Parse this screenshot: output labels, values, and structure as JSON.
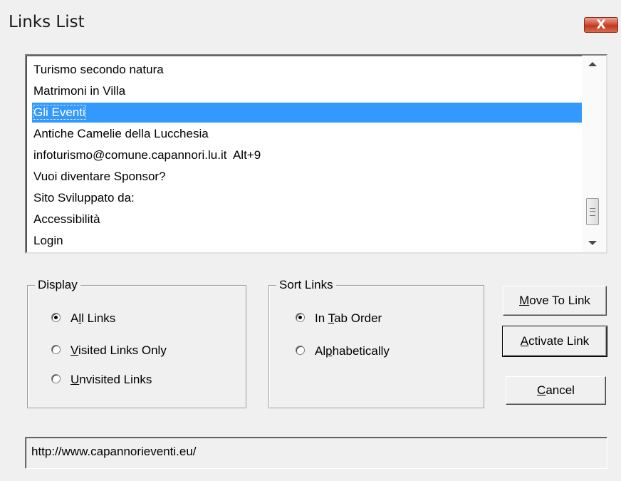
{
  "window": {
    "title": "Links List",
    "close_label": "X"
  },
  "links": [
    {
      "label": "Turismo secondo natura",
      "selected": false
    },
    {
      "label": "Matrimoni in Villa",
      "selected": false
    },
    {
      "label": "Gli Eventi",
      "selected": true
    },
    {
      "label": "Antiche Camelie della Lucchesia",
      "selected": false
    },
    {
      "label": "infoturismo@comune.capannori.lu.it  Alt+9",
      "selected": false
    },
    {
      "label": "Vuoi diventare Sponsor?",
      "selected": false
    },
    {
      "label": "Sito Sviluppato da:",
      "selected": false
    },
    {
      "label": "Accessibilità",
      "selected": false
    },
    {
      "label": "Login",
      "selected": false
    }
  ],
  "display": {
    "legend": "Display",
    "options": [
      {
        "pre": "A",
        "key": "l",
        "post": "l Links",
        "checked": true
      },
      {
        "pre": "",
        "key": "V",
        "post": "isited Links Only",
        "checked": false
      },
      {
        "pre": "",
        "key": "U",
        "post": "nvisited Links",
        "checked": false
      }
    ]
  },
  "sort": {
    "legend": "Sort Links",
    "options": [
      {
        "pre": "In ",
        "key": "T",
        "post": "ab Order",
        "checked": true
      },
      {
        "pre": "Al",
        "key": "p",
        "post": "habetically",
        "checked": false
      }
    ]
  },
  "buttons": {
    "move": {
      "key": "M",
      "post": "ove To Link"
    },
    "activate": {
      "key": "A",
      "post": "ctivate Link"
    },
    "cancel": {
      "key": "C",
      "post": "ancel"
    }
  },
  "url": "http://www.capannorieventi.eu/",
  "colors": {
    "selection": "#3399ff",
    "close": "#c0391f"
  }
}
